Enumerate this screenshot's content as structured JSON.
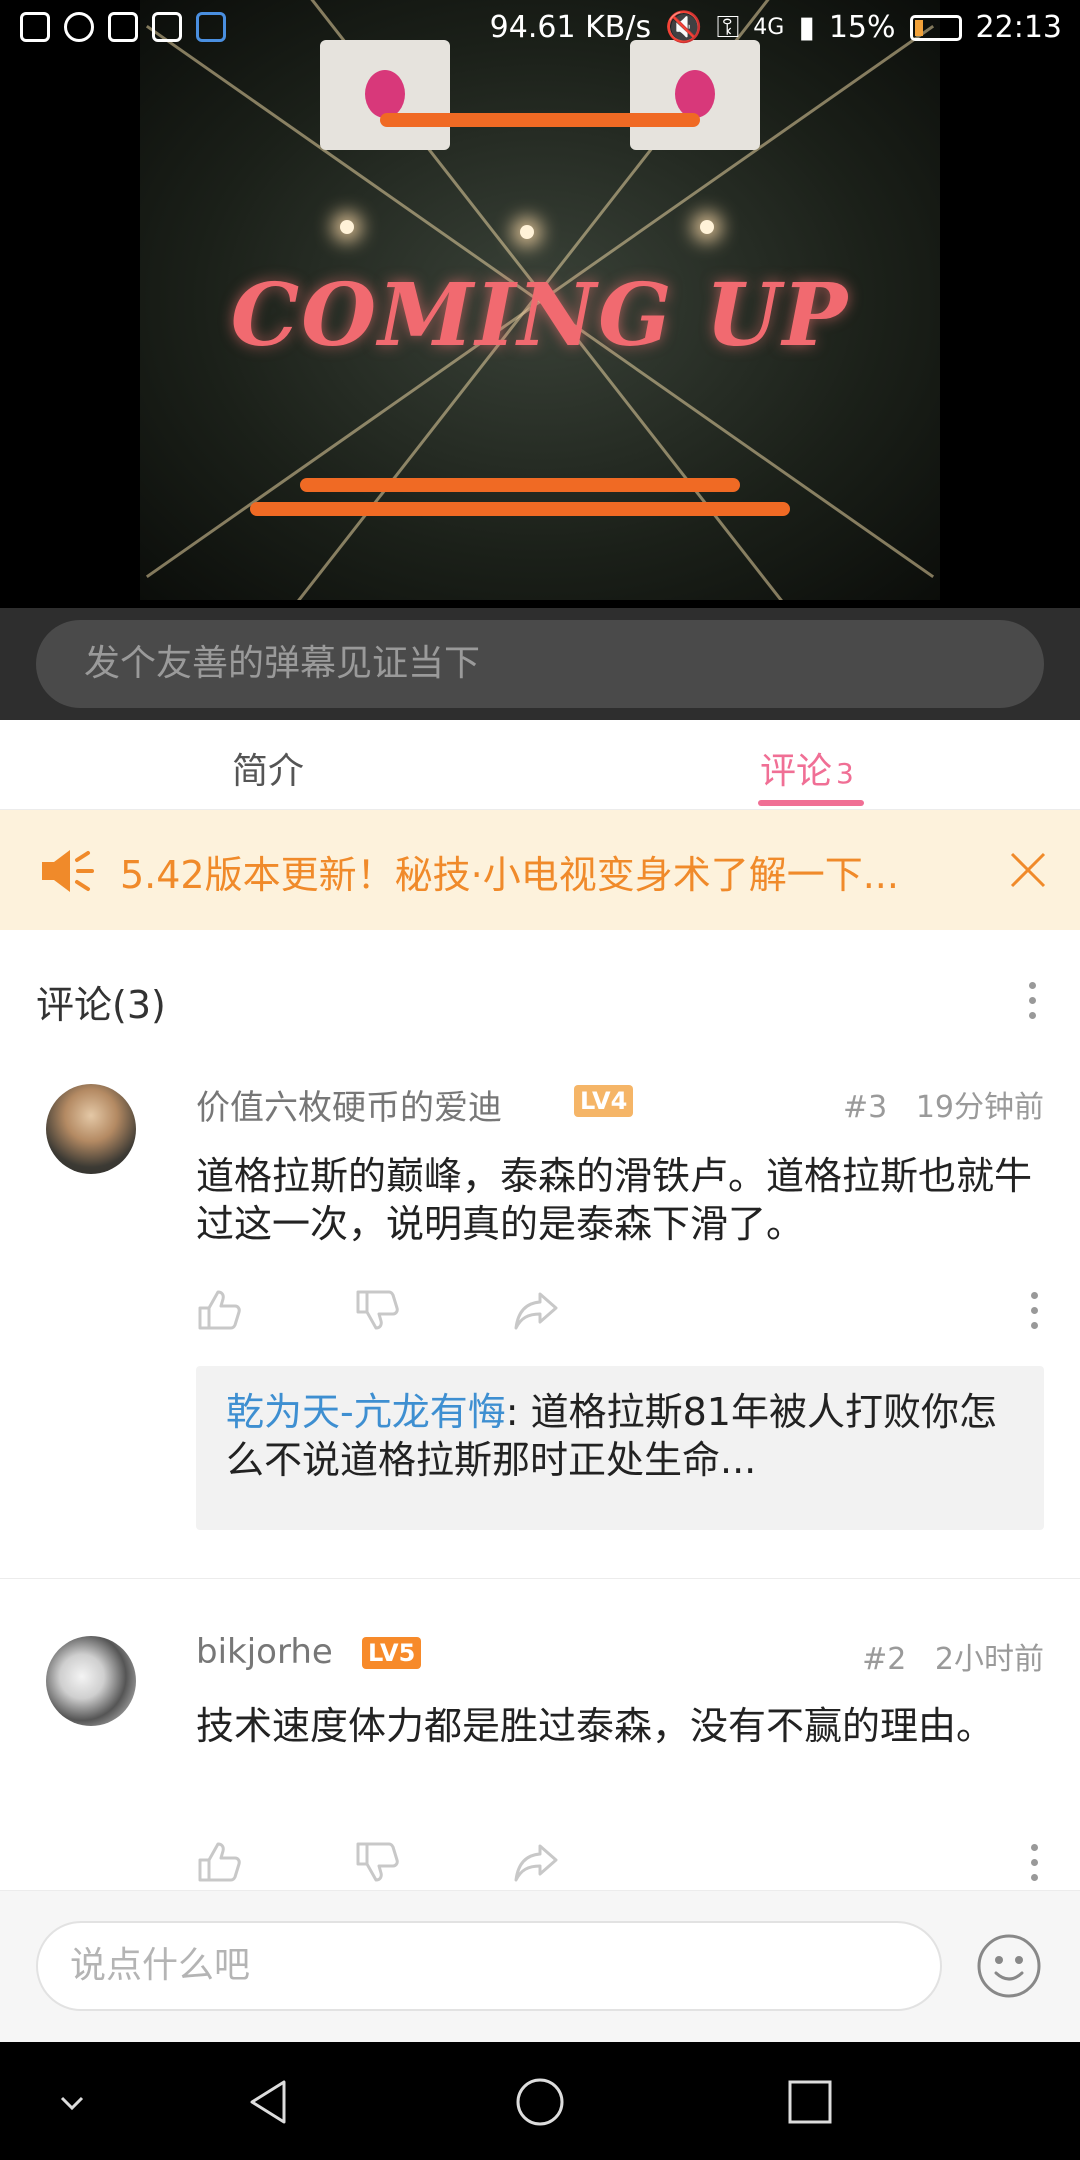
{
  "status_bar": {
    "speed": "94.61 KB/s",
    "network": "4G",
    "battery": "15%",
    "time": "22:13"
  },
  "video": {
    "overlay_text": "COMING UP"
  },
  "danmaku": {
    "placeholder": "发个友善的弹幕见证当下"
  },
  "tabs": {
    "intro": "简介",
    "comments": "评论",
    "comments_count": "3"
  },
  "notice": {
    "text": "5.42版本更新！秘技·小电视变身术了解一下..."
  },
  "comments_header": {
    "title": "评论(3)"
  },
  "comments": [
    {
      "username": "价值六枚硬币的爱迪",
      "level": "LV4",
      "floor": "#3",
      "time": "19分钟前",
      "text": "道格拉斯的巅峰，泰森的滑铁卢。道格拉斯也就牛过这一次，说明真的是泰森下滑了。",
      "reply": {
        "user": "乾为天-亢龙有悔",
        "text": ": 道格拉斯81年被人打败你怎么不说道格拉斯那时正处生命..."
      }
    },
    {
      "username": "bikjorhe",
      "level": "LV5",
      "floor": "#2",
      "time": "2小时前",
      "text": "技术速度体力都是胜过泰森，没有不赢的理由。"
    }
  ],
  "bottom": {
    "placeholder": "说点什么吧"
  },
  "colors": {
    "accent": "#f06f95",
    "notice_text": "#f08a2a",
    "notice_bg": "#fdf2dc",
    "reply_user": "#3e8fd1"
  },
  "icons": {
    "notice": "speaker-icon",
    "close": "close-icon",
    "like": "thumb-up-icon",
    "dislike": "thumb-down-icon",
    "share": "share-icon",
    "more": "more-vertical-icon",
    "emoji": "emoji-icon"
  }
}
